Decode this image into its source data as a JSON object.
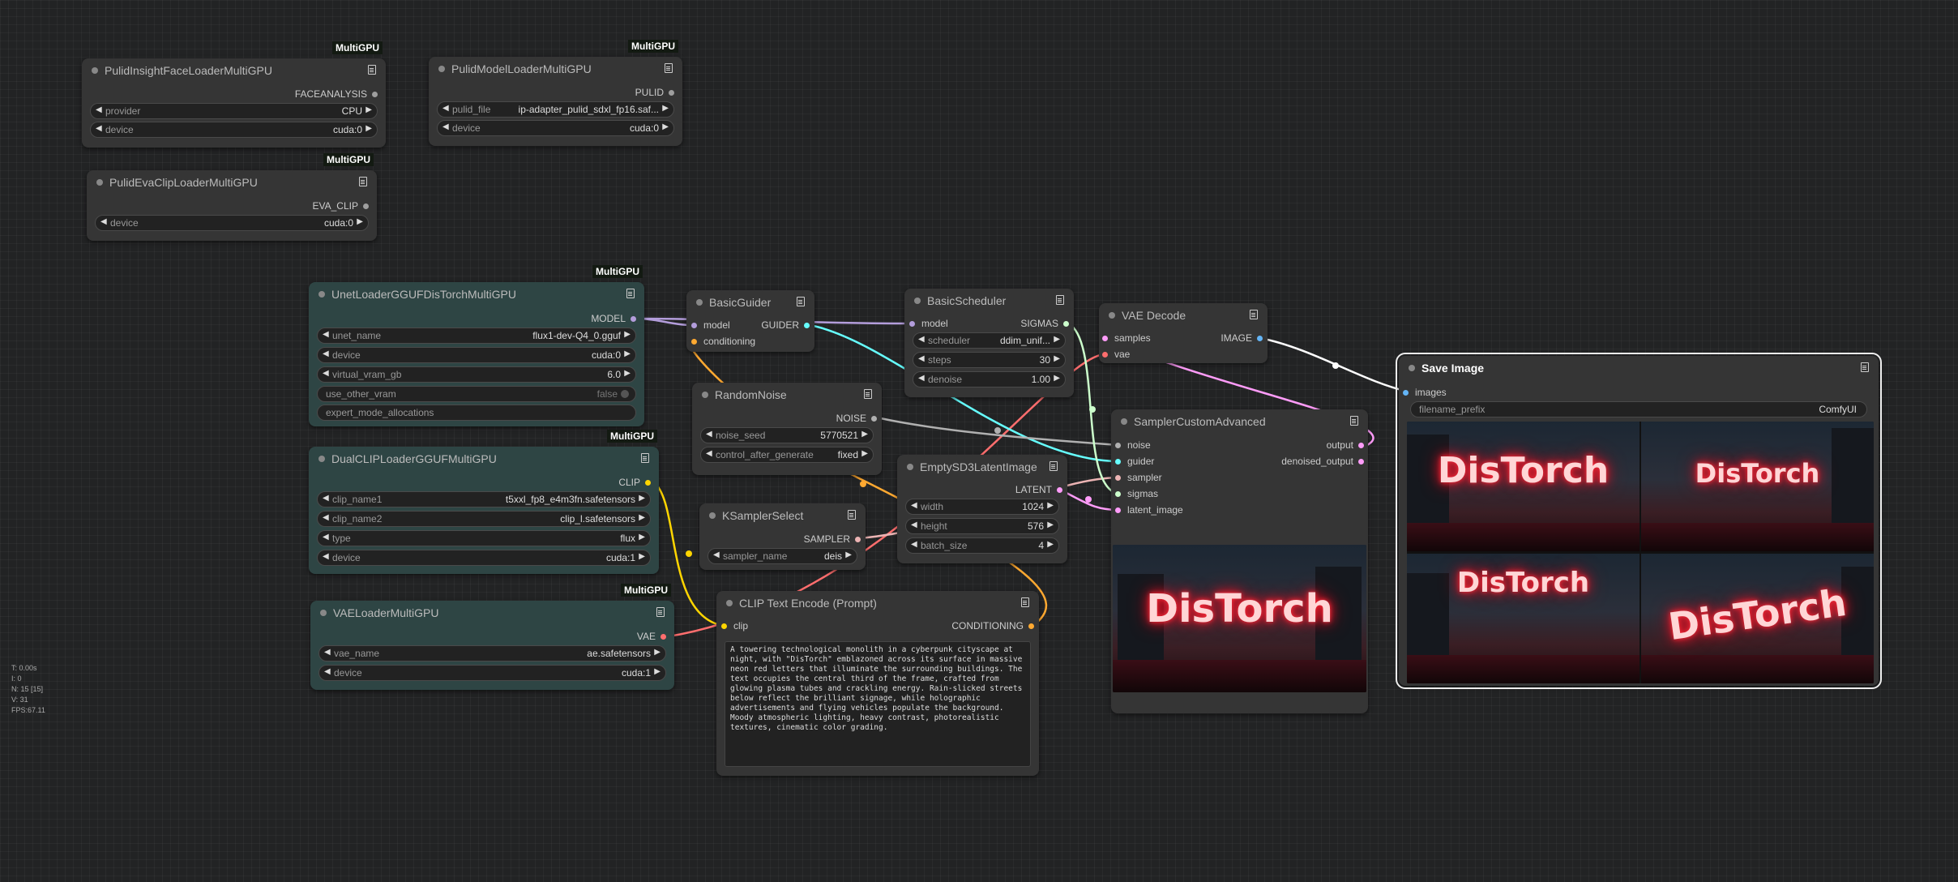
{
  "badge_text": "MultiGPU",
  "nodes": {
    "pulid_insight": {
      "title": "PulidInsightFaceLoaderMultiGPU",
      "output": "FACEANALYSIS",
      "widgets": [
        {
          "name": "provider",
          "value": "CPU"
        },
        {
          "name": "device",
          "value": "cuda:0"
        }
      ]
    },
    "pulid_model": {
      "title": "PulidModelLoaderMultiGPU",
      "output": "PULID",
      "widgets": [
        {
          "name": "pulid_file",
          "value": "ip-adapter_pulid_sdxl_fp16.saf..."
        },
        {
          "name": "device",
          "value": "cuda:0"
        }
      ]
    },
    "pulid_eva": {
      "title": "PulidEvaClipLoaderMultiGPU",
      "output": "EVA_CLIP",
      "widgets": [
        {
          "name": "device",
          "value": "cuda:0"
        }
      ]
    },
    "unet_loader": {
      "title": "UnetLoaderGGUFDisTorchMultiGPU",
      "output": "MODEL",
      "widgets": [
        {
          "name": "unet_name",
          "value": "flux1-dev-Q4_0.gguf"
        },
        {
          "name": "device",
          "value": "cuda:0"
        },
        {
          "name": "virtual_vram_gb",
          "value": "6.0"
        },
        {
          "name": "use_other_vram",
          "value": "false"
        },
        {
          "name": "expert_mode_allocations",
          "value": ""
        }
      ]
    },
    "dual_clip": {
      "title": "DualCLIPLoaderGGUFMultiGPU",
      "output": "CLIP",
      "widgets": [
        {
          "name": "clip_name1",
          "value": "t5xxl_fp8_e4m3fn.safetensors"
        },
        {
          "name": "clip_name2",
          "value": "clip_l.safetensors"
        },
        {
          "name": "type",
          "value": "flux"
        },
        {
          "name": "device",
          "value": "cuda:1"
        }
      ]
    },
    "vae_loader": {
      "title": "VAELoaderMultiGPU",
      "output": "VAE",
      "widgets": [
        {
          "name": "vae_name",
          "value": "ae.safetensors"
        },
        {
          "name": "device",
          "value": "cuda:1"
        }
      ]
    },
    "basic_guider": {
      "title": "BasicGuider",
      "inputs": [
        "model",
        "conditioning"
      ],
      "output": "GUIDER"
    },
    "random_noise": {
      "title": "RandomNoise",
      "output": "NOISE",
      "widgets": [
        {
          "name": "noise_seed",
          "value": "5770521"
        },
        {
          "name": "control_after_generate",
          "value": "fixed"
        }
      ]
    },
    "ksampler_select": {
      "title": "KSamplerSelect",
      "output": "SAMPLER",
      "widgets": [
        {
          "name": "sampler_name",
          "value": "deis"
        }
      ]
    },
    "basic_scheduler": {
      "title": "BasicScheduler",
      "inputs": [
        "model"
      ],
      "output": "SIGMAS",
      "widgets": [
        {
          "name": "scheduler",
          "value": "ddim_unif..."
        },
        {
          "name": "steps",
          "value": "30"
        },
        {
          "name": "denoise",
          "value": "1.00"
        }
      ]
    },
    "empty_latent": {
      "title": "EmptySD3LatentImage",
      "output": "LATENT",
      "widgets": [
        {
          "name": "width",
          "value": "1024"
        },
        {
          "name": "height",
          "value": "576"
        },
        {
          "name": "batch_size",
          "value": "4"
        }
      ]
    },
    "clip_text": {
      "title": "CLIP Text Encode (Prompt)",
      "inputs": [
        "clip"
      ],
      "output": "CONDITIONING",
      "text": "A towering technological monolith in a cyberpunk cityscape at night, with \"DisTorch\" emblazoned across its surface in massive neon red letters that illuminate the surrounding buildings. The text occupies the central third of the frame, crafted from glowing plasma tubes and crackling energy. Rain-slicked streets below reflect the brilliant signage, while holographic advertisements and flying vehicles populate the background. Moody atmospheric lighting, heavy contrast, photorealistic textures, cinematic color grading."
    },
    "vae_decode": {
      "title": "VAE Decode",
      "inputs": [
        "samples",
        "vae"
      ],
      "output": "IMAGE"
    },
    "sampler_custom": {
      "title": "SamplerCustomAdvanced",
      "inputs": [
        "noise",
        "guider",
        "sampler",
        "sigmas",
        "latent_image"
      ],
      "outputs": [
        "output",
        "denoised_output"
      ],
      "preview_text": "DisTorch"
    },
    "save_image": {
      "title": "Save Image",
      "inputs": [
        "images"
      ],
      "widgets": [
        {
          "name": "filename_prefix",
          "value": "ComfyUI"
        }
      ],
      "preview_texts": [
        "DisTorch",
        "DisTorch",
        "DisTorch",
        "DisTorch"
      ]
    }
  },
  "stats": {
    "t": "T: 0.00s",
    "i": "I: 0",
    "n": "N: 15 [15]",
    "v": "V: 31",
    "fps": "FPS:67.11"
  },
  "colors": {
    "model": "#b39ddb",
    "clip": "#ffd500",
    "vae": "#ff6e6e",
    "conditioning": "#ffa931",
    "guider": "#66ffff",
    "sigmas": "#ccffcc",
    "latent": "#ff9cf9",
    "image": "#64b5f6",
    "noise": "#b0b0b0",
    "sampler": "#ecb4b4"
  }
}
